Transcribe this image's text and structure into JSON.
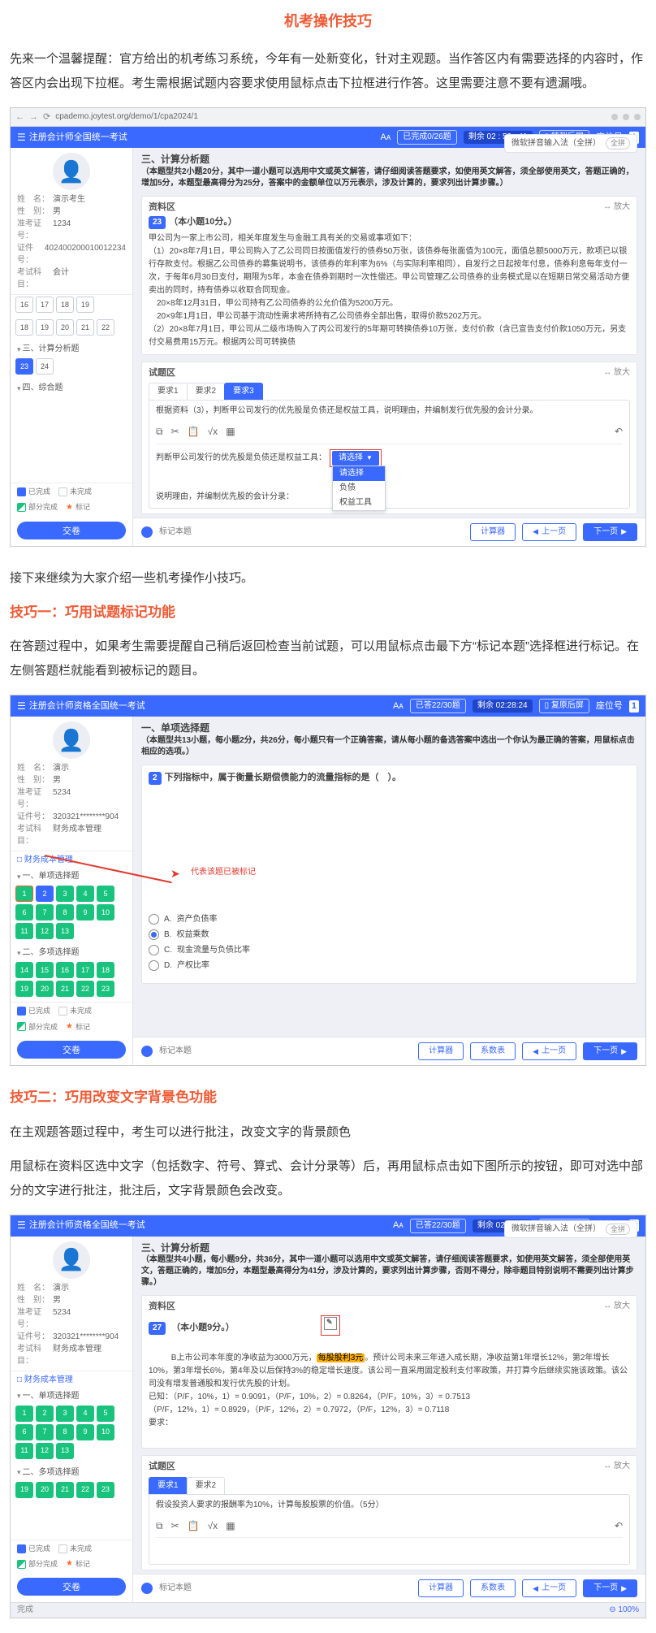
{
  "doc": {
    "title": "机考操作技巧",
    "intro": "先来一个温馨提醒：官方给出的机考练习系统，今年有一处新变化，针对主观题。当作答区内有需要选择的内容时，作答区内会出现下拉框。考生需根据试题内容要求使用鼠标点击下拉框进行作答。这里需要注意不要有遗漏哦。",
    "intro2": "接下来继续为大家介绍一些机考操作小技巧。",
    "tip1_title": "技巧一：巧用试题标记功能",
    "tip1_body": "在答题过程中，如果考生需要提醒自己稍后返回检查当前试题，可以用鼠标点击最下方“标记本题”选择框进行标记。在左侧答题栏就能看到被标记的题目。",
    "tip2_title": "技巧二：巧用改变文字背景色功能",
    "tip2_body1": "在主观题答题过程中，考生可以进行批注，改变文字的背景颜色",
    "tip2_body2": "用鼠标在资料区选中文字（包括数字、符号、算式、会计分录等）后，再用鼠标点击如下图所示的按钮，即可对选中部分的文字进行批注，批注后，文字背景颜色会改变。"
  },
  "shot1": {
    "url": "cpademo.joytest.org/demo/1/cpa2024/1",
    "exam_title": "注册会计师全国统一考试",
    "progress": "已完成0/26题",
    "timer": "剩余  02 : 59 : 41",
    "fullscreen": "▯ 转到后屏",
    "seat_label": "座位号",
    "seat_no": "1",
    "ime": "微软拼音输入法（全拼）",
    "user": {
      "name_lbl": "姓　名：",
      "name": "演示考生",
      "sex_lbl": "性　别：",
      "sex": "男",
      "id_lbl": "准考证号：",
      "id": "1234",
      "cert_lbl": "证件号：",
      "cert": "402400200010012234",
      "subj_lbl": "考试科目：",
      "subj": "会计"
    },
    "sections": {
      "s3": "三、计算分析题",
      "s3_nums": [
        "23",
        "24"
      ],
      "s4": "四、综合题"
    },
    "legend": {
      "done": "已完成",
      "undone": "未完成",
      "part": "部分完成",
      "mark": "标记"
    },
    "row1_nums": [
      "16",
      "17",
      "18",
      "19"
    ],
    "row2_nums": [
      "18",
      "19",
      "20",
      "21",
      "22"
    ],
    "submit": "交卷",
    "q": {
      "heading": "三、计算分析题",
      "desc": "（本题型共2小题20分，其中一道小题可以选用中文或英文解答，请仔细阅读答题要求，如使用英文解答，须全部使用英文，答题正确的，增加5分，本题型最高得分为25分，答案中的金额单位以万元表示，涉及计算的，要求列出计算步骤。）",
      "material_label": "资料区",
      "expand": "↔ 放大",
      "num": "23",
      "num_label": "（本小题10分。）",
      "body": "甲公司为一家上市公司，相关年度发生与金融工具有关的交易或事项如下：\n（1）20×8年7月1日，甲公司购入了乙公司同日按面值发行的债券50万张，该债券每张面值为100元，面值总额5000万元，款项已以银行存款支付。根据乙公司债券的募集说明书，该债券的年利率为6%（与实际利率相同），自发行之日起按年付息，债券利息每年支付一次，于每年6月30日支付，期限为5年，本金在债券到期时一次性偿还。甲公司管理乙公司债券的业务模式是以在短期日常交易活动方便卖出的同时，持有债券以收取合同现金。\n　20×8年12月31日，甲公司持有乙公司债券的公允价值为5200万元。\n　20×9年1月1日，甲公司基于流动性需求将所持有乙公司债券全部出售，取得价款5202万元。\n（2）20×8年7月1日，甲公司从二级市场购入了丙公司发行的5年期可转换债券10万张，支付价款（含已宣告支付价款1050万元，另支付交易费用15万元。根据丙公司可转换债",
      "answer_label": "试题区",
      "tabs": [
        "要求1",
        "要求2",
        "要求3"
      ],
      "task": "根据资料（3），判断甲公司发行的优先股是负债还是权益工具，说明理由，并编制发行优先股的会计分录。",
      "answer_prefix": "判断甲公司发行的优先股是负债还是权益工具：",
      "answer_note": "说明理由，并编制优先股的会计分录：",
      "dd_btn": "请选择",
      "dd_opts": [
        "请选择",
        "负债",
        "权益工具"
      ]
    },
    "bottom": {
      "mark": "标记本题",
      "calc": "计算器",
      "prev": "上一页",
      "next": "下一页"
    }
  },
  "shot2": {
    "exam_title": "注册会计师资格全国统一考试",
    "progress": "已答22/30题",
    "timer": "剩余  02:28:24",
    "fullscreen": "▯ 复原后屏",
    "seat_label": "座位号",
    "seat_no": "1",
    "user": {
      "name_lbl": "姓　名：",
      "name": "演示",
      "sex_lbl": "性　别：",
      "sex": "男",
      "id_lbl": "准考证号：",
      "id": "5234",
      "cert_lbl": "证件号：",
      "cert": "320321********904",
      "subj_lbl": "考试科目：",
      "subj": "财务成本管理"
    },
    "link": "□ 财务成本管理",
    "s1": "一、单项选择题",
    "s1_grid": [
      [
        "1",
        "done mark-green-border"
      ],
      [
        "2",
        "active"
      ],
      [
        "3",
        "done"
      ],
      [
        "4",
        "done"
      ],
      [
        "5",
        "done"
      ],
      [
        "6",
        "done"
      ],
      [
        "7",
        "done"
      ],
      [
        "8",
        "done"
      ],
      [
        "9",
        "done"
      ],
      [
        "10",
        "done"
      ],
      [
        "11",
        "done"
      ],
      [
        "12",
        "done"
      ],
      [
        "13",
        "done"
      ]
    ],
    "s2": "二、多项选择题",
    "s2_grid": [
      [
        "14",
        "done"
      ],
      [
        "15",
        "done"
      ],
      [
        "16",
        "done"
      ],
      [
        "17",
        "done"
      ],
      [
        "18",
        "done"
      ],
      [
        "19",
        "done"
      ],
      [
        "20",
        "done"
      ],
      [
        "21",
        "done"
      ],
      [
        "22",
        "done"
      ],
      [
        "23",
        "done"
      ]
    ],
    "arrow_label": "代表该题已被标记",
    "legend": {
      "done": "已完成",
      "undone": "未完成",
      "part": "部分完成",
      "mark": "标记"
    },
    "submit": "交卷",
    "q": {
      "heading": "一、单项选择题",
      "desc": "（本题型共13小题，每小题2分，共26分，每小题只有一个正确答案，请从每小题的备选答案中选出一个你认为最正确的答案，用鼠标点击相应的选项。）",
      "num": "2",
      "stem": "下列指标中，属于衡量长期偿债能力的流量指标的是（　）。",
      "opts": [
        {
          "k": "A",
          "t": "资产负债率",
          "checked": false
        },
        {
          "k": "B",
          "t": "权益乘数",
          "checked": true
        },
        {
          "k": "C",
          "t": "现金流量与负债比率",
          "checked": false
        },
        {
          "k": "D",
          "t": "产权比率",
          "checked": false
        }
      ]
    },
    "bottom": {
      "mark": "标记本题",
      "calc": "计算器",
      "table": "系数表",
      "prev": "上一页",
      "next": "下一页"
    }
  },
  "shot3": {
    "exam_title": "注册会计师资格全国统一考试",
    "progress": "已答22/30题",
    "timer": "剩余  02:22:25",
    "fullscreen": "▯ 复原后屏",
    "seat_label": "座位号",
    "seat_no": "1",
    "ime": "微软拼音输入法（全拼）",
    "user": {
      "name_lbl": "姓　名：",
      "name": "演示",
      "sex_lbl": "性　别：",
      "sex": "男",
      "id_lbl": "准考证号：",
      "id": "5234",
      "cert_lbl": "证件号：",
      "cert": "320321********904",
      "subj_lbl": "考试科目：",
      "subj": "财务成本管理"
    },
    "link": "□ 财务成本管理",
    "s1": "一、单项选择题",
    "s1_grid": [
      [
        "1",
        "done"
      ],
      [
        "2",
        "done"
      ],
      [
        "3",
        "done"
      ],
      [
        "4",
        "done"
      ],
      [
        "5",
        "done"
      ],
      [
        "6",
        "done"
      ],
      [
        "7",
        "done"
      ],
      [
        "8",
        "done"
      ],
      [
        "9",
        "done"
      ],
      [
        "10",
        "done"
      ],
      [
        "11",
        "done"
      ],
      [
        "12",
        "done"
      ],
      [
        "13",
        "done"
      ]
    ],
    "s2": "二、多项选择题",
    "s2_grid": [
      [
        "19",
        "done"
      ],
      [
        "20",
        "done"
      ],
      [
        "21",
        "done"
      ],
      [
        "22",
        "done"
      ],
      [
        "23",
        "done"
      ]
    ],
    "legend": {
      "done": "已完成",
      "undone": "未完成",
      "part": "部分完成",
      "mark": "标记"
    },
    "submit": "交卷",
    "q": {
      "heading": "三、计算分析题",
      "desc": "（本题型共4小题，每小题9分，共36分，其中一道小题可以选用中文或英文解答，请仔细阅读答题要求，如使用英文解答，须全部使用英文，答题正确的，增加5分，本题型最高得分为41分，涉及计算的，要求列出计算步骤，否则不得分，除非题目特别说明不需要列出计算步骤。）",
      "material_label": "资料区",
      "expand": "↔ 放大",
      "num": "27",
      "num_label": "（本小题9分。）",
      "body_pre": "B上市公司本年度的净收益为3000万元，",
      "body_hl": "每股股利3元",
      "body_post": "。预计公司未来三年进入成长期，净收益第1年增长12%，第2年增长10%，第3年增长6%，第4年及以后保持3%的稳定增长速度。该公司一直采用固定股利支付率政策，并打算今后继续实施该政策。该公司没有增发普通股和发行优先股的计划。\n已知：（P/F，10%，1）= 0.9091，（P/F，10%，2）= 0.8264，（P/F，10%，3）= 0.7513\n（P/F，12%，1）= 0.8929，（P/F，12%，2）= 0.7972，（P/F，12%，3）= 0.7118\n要求：",
      "answer_label": "试题区",
      "tabs": [
        "要求1",
        "要求2"
      ],
      "task": "假设投资人要求的报酬率为10%，计算每股股票的价值。（5分）"
    },
    "bottom": {
      "mark": "标记本题",
      "calc": "计算器",
      "table": "系数表",
      "prev": "上一页",
      "next": "下一页"
    },
    "status": {
      "done": "完成",
      "zoom": "⊖ 100%"
    }
  }
}
